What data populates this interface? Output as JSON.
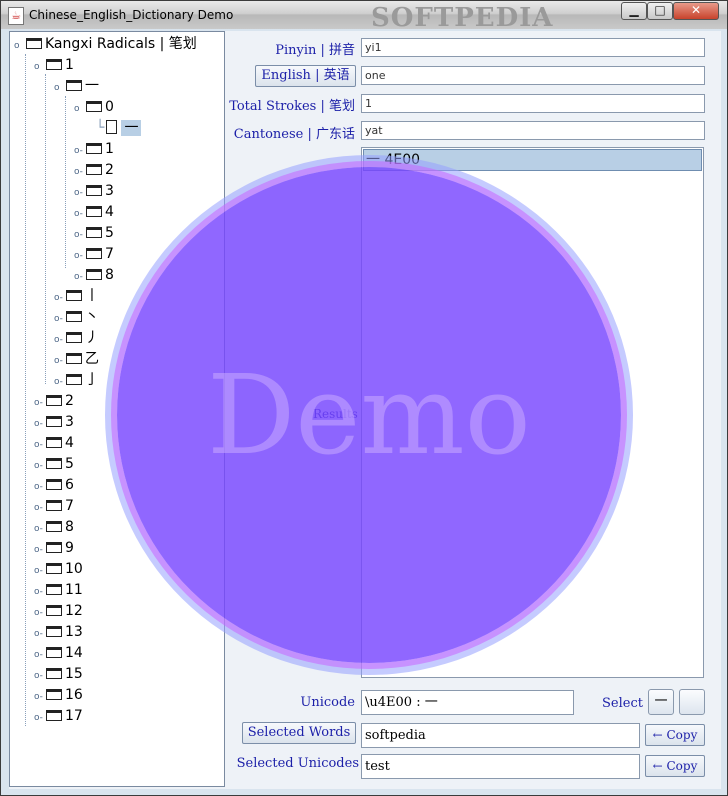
{
  "window": {
    "title": "Chinese_English_Dictionary Demo",
    "watermark": "SOFTPEDIA",
    "min": "▁",
    "max": "□",
    "close": "✕"
  },
  "tree": {
    "root": "Kangxi Radicals | 笔划",
    "l1": "1",
    "l2": "一",
    "l3_0": "0",
    "leaf": "一",
    "l3": [
      "1",
      "2",
      "3",
      "4",
      "5",
      "7",
      "8"
    ],
    "l2_more": [
      "丨",
      "丶",
      "丿",
      "乙",
      "亅"
    ],
    "l1_more": [
      "2",
      "3",
      "4",
      "5",
      "6",
      "7",
      "8",
      "9",
      "10",
      "11",
      "12",
      "13",
      "14",
      "15",
      "16",
      "17"
    ]
  },
  "form": {
    "pinyin_label": "Pinyin | 拼音",
    "pinyin_value": "yi1",
    "english_button": "English | 英语",
    "english_value": "one",
    "strokes_label": "Total Strokes | 笔划",
    "strokes_value": "1",
    "cantonese_label": "Cantonese | 广东话",
    "cantonese_value": "yat"
  },
  "results": {
    "label": "Results",
    "items": [
      "一 4E00"
    ]
  },
  "bottom": {
    "unicode_label": "Unicode",
    "unicode_value": "\\u4E00 : 一",
    "select_label": "Select",
    "select_char": "一",
    "selected_words_button": "Selected Words",
    "selected_words_value": "softpedia",
    "selected_unicodes_label": "Selected Unicodes",
    "selected_unicodes_value": "test",
    "copy_label": "← Copy"
  },
  "overlay": {
    "text": "Demo"
  }
}
